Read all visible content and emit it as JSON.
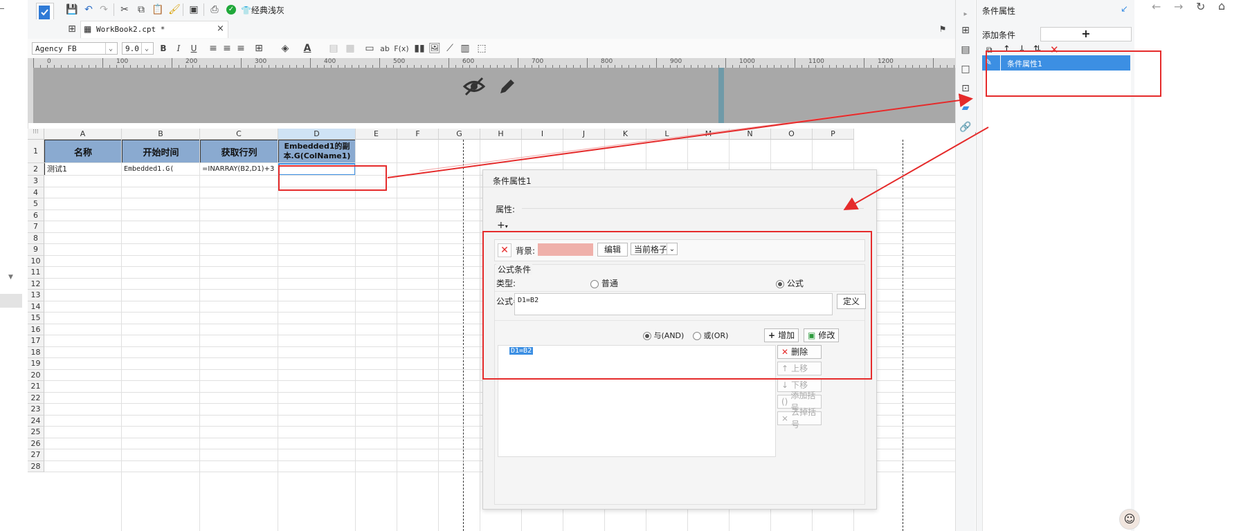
{
  "toolbar": {
    "theme_label": "经典浅灰"
  },
  "tab": {
    "filename": "WorkBook2.cpt *",
    "close": "×"
  },
  "format": {
    "font": "Agency FB",
    "size": "9.0",
    "bold": "B",
    "italic": "I",
    "underline": "U",
    "text_color": "A",
    "formula_btn": "F(x)",
    "ab": "ab"
  },
  "ruler": [
    "0",
    "100",
    "200",
    "300",
    "400",
    "500",
    "600",
    "700",
    "800",
    "900",
    "1000",
    "1100",
    "1200"
  ],
  "columns": [
    "A",
    "B",
    "C",
    "D",
    "E",
    "F",
    "G",
    "H",
    "I",
    "J",
    "K",
    "L",
    "M",
    "N",
    "O",
    "P"
  ],
  "rows": [
    "1",
    "2",
    "3",
    "4",
    "5",
    "6",
    "7",
    "8",
    "9",
    "10",
    "11",
    "12",
    "13",
    "14",
    "15",
    "16",
    "17",
    "18",
    "19",
    "20",
    "21",
    "22",
    "23",
    "24",
    "25",
    "26",
    "27",
    "28"
  ],
  "table": {
    "headers": [
      "名称",
      "开始时间",
      "获取行列",
      "Embedded1的副本.G(ColName1)"
    ],
    "row2": [
      "测试1",
      "Embedded1.G(",
      "=INARRAY(B2,D1)+3",
      ""
    ]
  },
  "right_panel": {
    "title": "条件属性",
    "add_condition": "添加条件",
    "add_symbol": "+",
    "list_item": "条件属性1"
  },
  "dialog": {
    "title": "条件属性1",
    "attr_label": "属性:",
    "background_label": "背景:",
    "edit_btn": "编辑",
    "scope_select": "当前格子",
    "formula_cond": "公式条件",
    "type_label": "类型:",
    "type_normal": "普通",
    "type_formula": "公式",
    "formula_label": "公式=",
    "formula_value": "D1=B2",
    "define_btn": "定义",
    "and_label": "与(AND)",
    "or_label": "或(OR)",
    "add_btn": "增加",
    "modify_btn": "修改",
    "delete_btn": "删除",
    "move_up_btn": "上移",
    "move_down_btn": "下移",
    "add_bracket_btn": "添加括号",
    "remove_bracket_btn": "去掉括号",
    "condition_item": "D1=B2"
  },
  "colors": {
    "accent": "#3c8fe3",
    "header_fill": "#8aaad0",
    "bg_swatch": "#efb0aa",
    "annotation": "#e52b2b"
  }
}
